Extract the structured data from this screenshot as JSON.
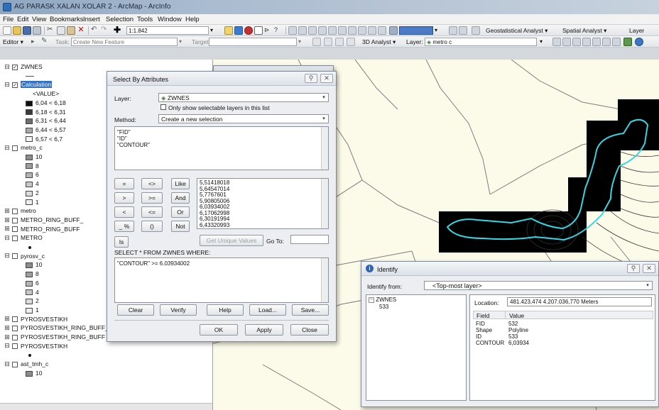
{
  "window": {
    "title": "AG PARASK XALAN XOLAR 2 - ArcMap - ArcInfo"
  },
  "menu": [
    "File",
    "Edit",
    "View",
    "Bookmarks",
    "Insert",
    "Selection",
    "Tools",
    "Window",
    "Help"
  ],
  "toolbar1": {
    "scale": "1:1.842",
    "geostat": "Geostatistical Analyst ▾",
    "spatial": "Spatial Analyst ▾",
    "layer_label": "Layer"
  },
  "toolbar2": {
    "editor": "Editor ▾",
    "task_label": "Task:",
    "task_value": "Create New Feature",
    "target_label": "Target:",
    "analyst3d": "3D Analyst ▾",
    "layer_label": "Layer:",
    "layer_value": "metro c"
  },
  "toc": {
    "items": [
      {
        "type": "layer",
        "name": "ZWNES",
        "expander": "⊟",
        "checked": true
      },
      {
        "type": "line"
      },
      {
        "type": "layer",
        "name": "Calculation",
        "expander": "⊟",
        "checked": true,
        "selected": true
      },
      {
        "type": "text",
        "name": "<VALUE>"
      },
      {
        "type": "class",
        "name": "6,04 < 6,18",
        "color": "#101010"
      },
      {
        "type": "class",
        "name": "6,18 < 6,31",
        "color": "#3a3a3a"
      },
      {
        "type": "class",
        "name": "6,31 < 6,44",
        "color": "#6e6e6e"
      },
      {
        "type": "class",
        "name": "6,44 < 6,57",
        "color": "#a8a8a8"
      },
      {
        "type": "class",
        "name": "6,57 < 6,7",
        "color": "#f4f4f4"
      },
      {
        "type": "layer",
        "name": "metro_c",
        "expander": "⊟",
        "checked": false
      },
      {
        "type": "class",
        "name": "10",
        "color": "#8c8c8c"
      },
      {
        "type": "class",
        "name": "8",
        "color": "#9e9e9e"
      },
      {
        "type": "class",
        "name": "6",
        "color": "#b4b4b4"
      },
      {
        "type": "class",
        "name": "4",
        "color": "#c8c8c8"
      },
      {
        "type": "class",
        "name": "2",
        "color": "#dcdcdc"
      },
      {
        "type": "class",
        "name": "1",
        "color": "#efefef"
      },
      {
        "type": "layer",
        "name": "metro",
        "expander": "⊞",
        "checked": false
      },
      {
        "type": "layer",
        "name": "METRO_RING_BUFF_",
        "expander": "⊞",
        "checked": false
      },
      {
        "type": "layer",
        "name": "METRO_RING_BUFF",
        "expander": "⊞",
        "checked": false
      },
      {
        "type": "layer",
        "name": "METRO",
        "expander": "⊟",
        "checked": false
      },
      {
        "type": "dot"
      },
      {
        "type": "layer",
        "name": "pyrosv_c",
        "expander": "⊟",
        "checked": false
      },
      {
        "type": "class",
        "name": "10",
        "color": "#8c8c8c"
      },
      {
        "type": "class",
        "name": "8",
        "color": "#9e9e9e"
      },
      {
        "type": "class",
        "name": "6",
        "color": "#b4b4b4"
      },
      {
        "type": "class",
        "name": "4",
        "color": "#c8c8c8"
      },
      {
        "type": "class",
        "name": "2",
        "color": "#dcdcdc"
      },
      {
        "type": "class",
        "name": "1",
        "color": "#efefef"
      },
      {
        "type": "layer",
        "name": "PYROSVESTIKH",
        "expander": "⊞",
        "checked": false
      },
      {
        "type": "layer",
        "name": "PYROSVESTIKH_RING_BUFF_1",
        "expander": "⊞",
        "checked": false
      },
      {
        "type": "layer",
        "name": "PYROSVESTIKH_RING_BUFF",
        "expander": "⊞",
        "checked": false
      },
      {
        "type": "layer",
        "name": "PYROSVESTIKH",
        "expander": "⊟",
        "checked": false
      },
      {
        "type": "dot"
      },
      {
        "type": "layer",
        "name": "ast_tmh_c",
        "expander": "⊟",
        "checked": false
      },
      {
        "type": "class",
        "name": "10",
        "color": "#8c8c8c"
      }
    ]
  },
  "select_dialog": {
    "title": "Select By Attributes",
    "layer_label": "Layer:",
    "layer_value": "ZWNES",
    "only_selectable_label": "Only show selectable layers in this list",
    "method_label": "Method:",
    "method_value": "Create a new selection",
    "fields": [
      "\"FID\"",
      "\"ID\"",
      "\"CONTOUR\""
    ],
    "operators": [
      [
        "=",
        "<>",
        "Like"
      ],
      [
        ">",
        ">=",
        "And"
      ],
      [
        "<",
        "<=",
        "Or"
      ],
      [
        "_ %",
        "()",
        "Not"
      ]
    ],
    "is_label": "Is",
    "unique_values": [
      "5,51418018",
      "5,64547014",
      "5,7767601",
      "5,90805006",
      "6,03934002",
      "6,17062998",
      "6,30191994",
      "6,43320993"
    ],
    "get_unique_label": "Get Unique Values",
    "goto_label": "Go To:",
    "sql_prefix": "SELECT * FROM ZWNES WHERE:",
    "expression": "\"CONTOUR\" >= 6.03934002",
    "buttons": [
      "Clear",
      "Verify",
      "Help",
      "Load...",
      "Save..."
    ],
    "ok": "OK",
    "apply": "Apply",
    "close": "Close"
  },
  "identify": {
    "title": "Identify",
    "identify_from_label": "Identify from:",
    "identify_from_value": "<Top-most layer>",
    "tree_layer": "ZWNES",
    "tree_child": "533",
    "location_label": "Location:",
    "location_value": "481.423,474  4.207.036,770 Meters",
    "col_field": "Field",
    "col_value": "Value",
    "rows": [
      {
        "field": "FID",
        "value": "532"
      },
      {
        "field": "Shape",
        "value": "Polyline"
      },
      {
        "field": "ID",
        "value": "533"
      },
      {
        "field": "CONTOUR",
        "value": "6,03934"
      }
    ]
  }
}
